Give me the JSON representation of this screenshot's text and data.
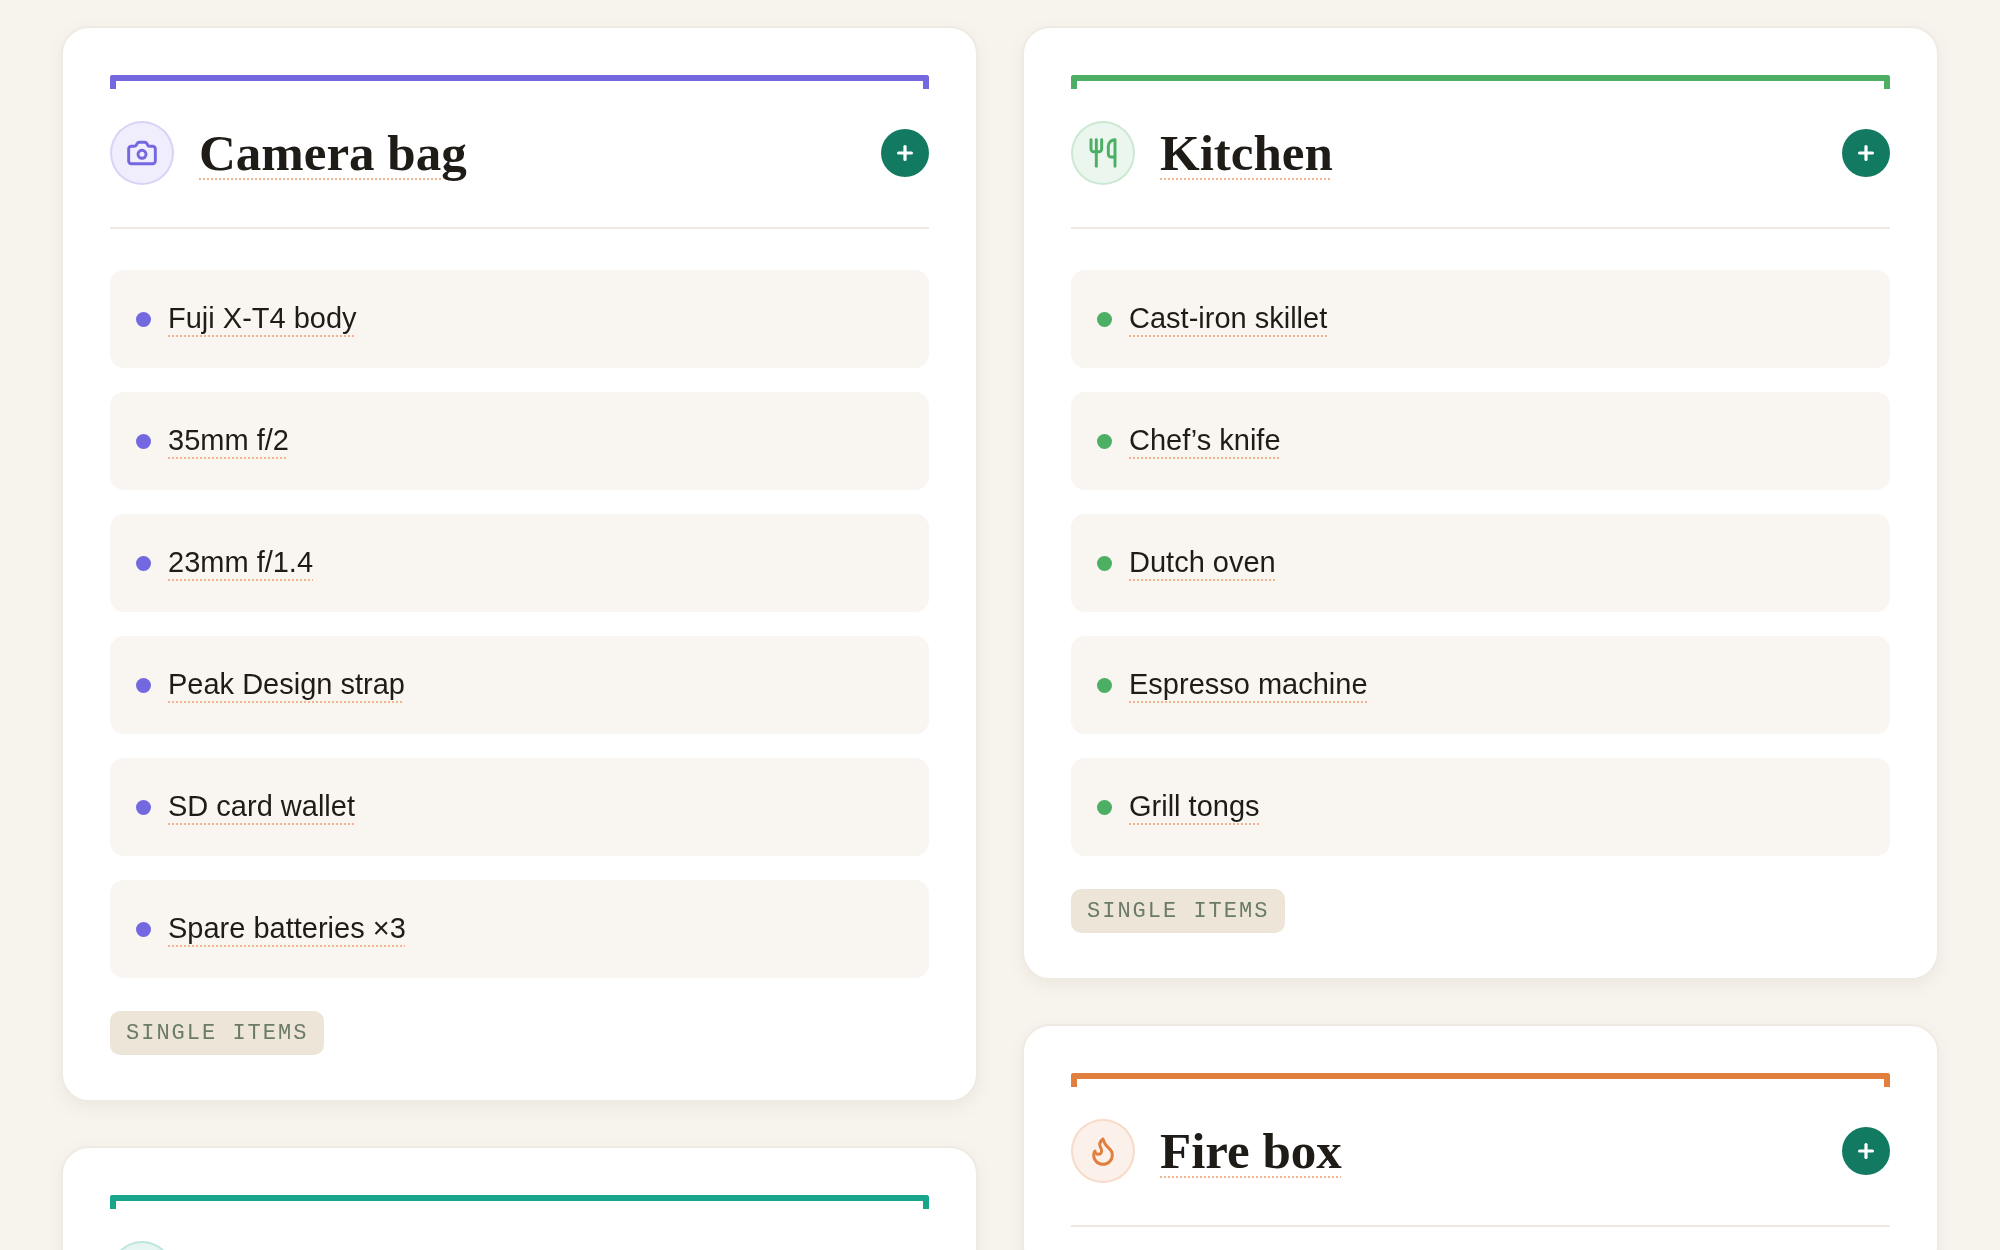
{
  "columns": [
    {
      "cards": [
        {
          "title": "Camera bag",
          "color": "#7468e0",
          "items": [
            "Fuji X-T4 body",
            "35mm f/2",
            "23mm f/1.4",
            "Peak Design strap",
            "SD card wallet",
            "Spare batteries ×3"
          ],
          "tag": "SINGLE ITEMS"
        },
        {
          "color": "#17a58c"
        }
      ]
    },
    {
      "cards": [
        {
          "title": "Kitchen",
          "color": "#4caf64",
          "items": [
            "Cast-iron skillet",
            "Chef’s knife",
            "Dutch oven",
            "Espresso machine",
            "Grill tongs"
          ],
          "tag": "SINGLE ITEMS"
        },
        {
          "title": "Fire box",
          "color": "#e07f3e"
        }
      ]
    }
  ]
}
